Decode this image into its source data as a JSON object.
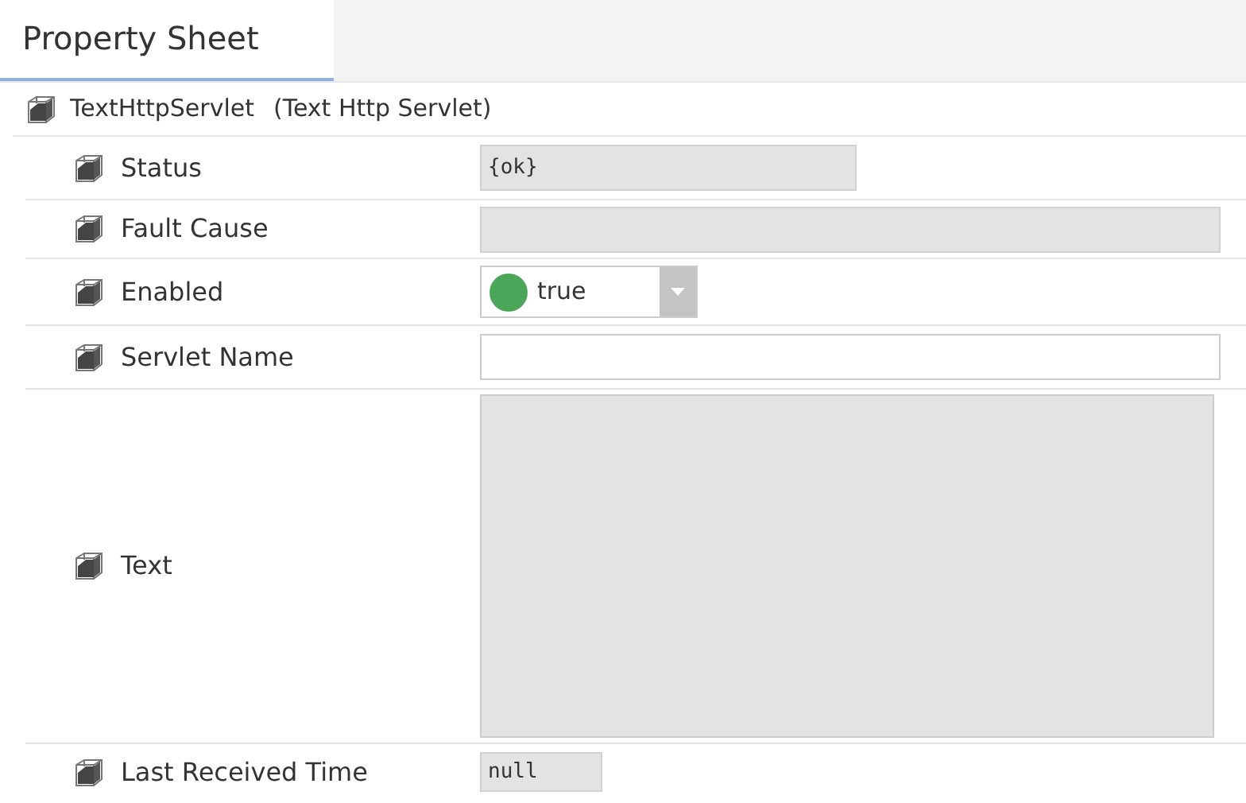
{
  "tabs": [
    {
      "label": "Property Sheet",
      "selected": true
    }
  ],
  "root": {
    "name": "TextHttpServlet",
    "display_name": "(Text Http Servlet)"
  },
  "properties": [
    {
      "label": "Status",
      "kind": "readonly",
      "value": "{ok}"
    },
    {
      "label": "Fault Cause",
      "kind": "readonly-wide"
    },
    {
      "label": "Enabled",
      "kind": "dropdown",
      "value": "true",
      "on": true
    },
    {
      "label": "Servlet Name",
      "kind": "text"
    },
    {
      "label": "Text",
      "kind": "textarea"
    },
    {
      "label": "Last Received Time",
      "kind": "readonly-small",
      "value": "null"
    }
  ]
}
